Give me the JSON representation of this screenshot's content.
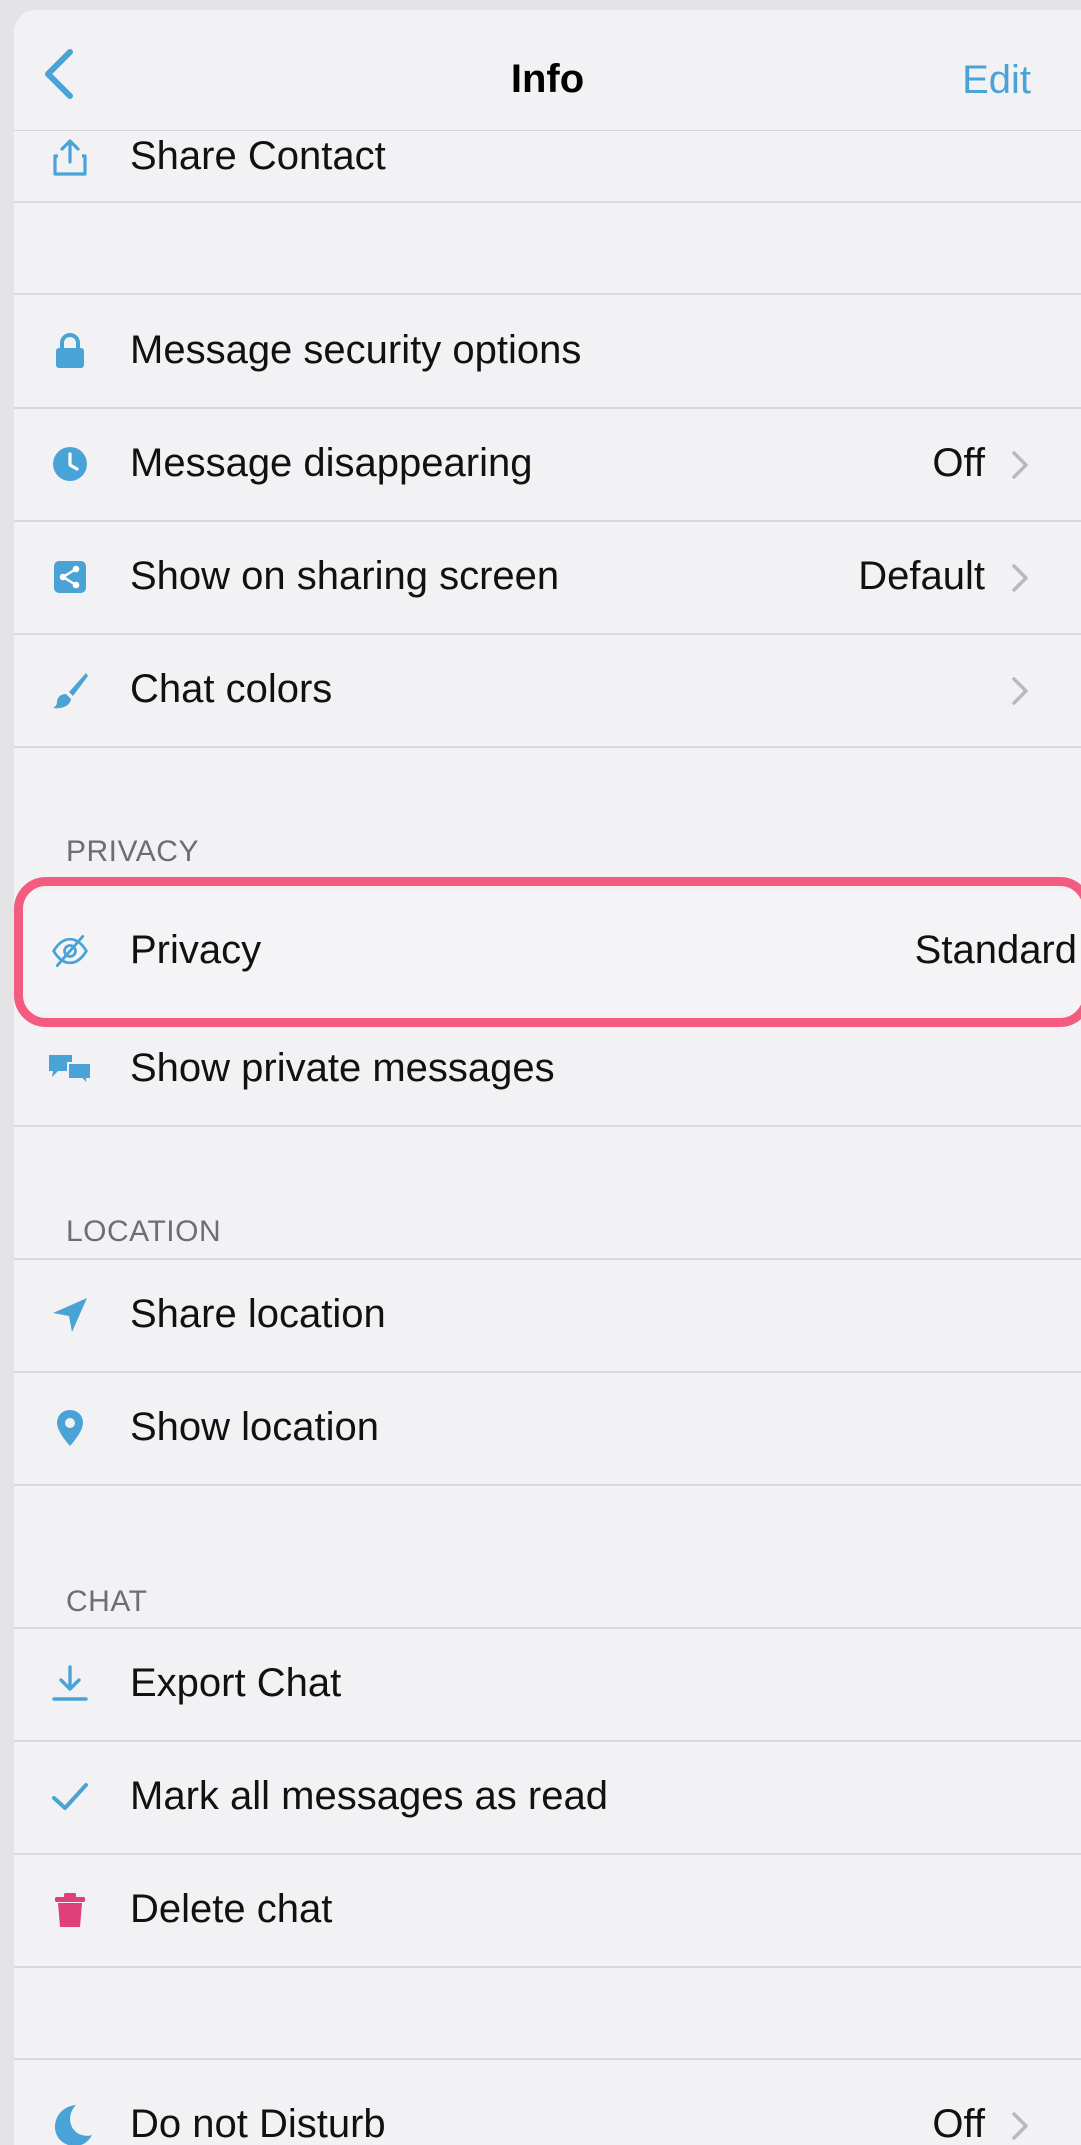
{
  "nav": {
    "title": "Info",
    "edit_label": "Edit"
  },
  "rows": {
    "share_contact": "Share Contact",
    "message_security": "Message security options",
    "message_disappearing": "Message disappearing",
    "message_disappearing_value": "Off",
    "show_on_sharing": "Show on sharing screen",
    "show_on_sharing_value": "Default",
    "chat_colors": "Chat colors",
    "privacy": "Privacy",
    "privacy_value": "Standard",
    "show_private_messages": "Show private messages",
    "share_location": "Share location",
    "show_location": "Show location",
    "export_chat": "Export Chat",
    "mark_all_read": "Mark all messages as read",
    "delete_chat": "Delete chat",
    "do_not_disturb": "Do not Disturb",
    "do_not_disturb_value": "Off"
  },
  "sections": {
    "privacy": "PRIVACY",
    "location": "LOCATION",
    "chat": "CHAT"
  },
  "colors": {
    "accent": "#4aa3d6",
    "destructive": "#e0407a",
    "highlight": "#f45b80"
  }
}
